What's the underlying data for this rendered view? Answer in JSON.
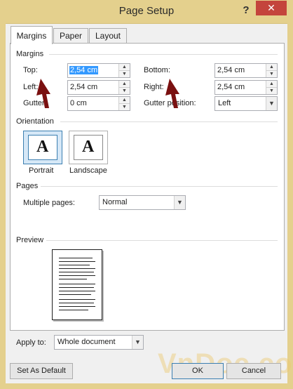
{
  "window": {
    "title": "Page Setup",
    "help": "?",
    "close": "✕"
  },
  "tabs": [
    {
      "label": "Margins",
      "active": true
    },
    {
      "label": "Paper",
      "active": false
    },
    {
      "label": "Layout",
      "active": false
    }
  ],
  "margins": {
    "section": "Margins",
    "top": {
      "label": "Top:",
      "value": "2,54 cm"
    },
    "bottom": {
      "label": "Bottom:",
      "value": "2,54 cm"
    },
    "left": {
      "label": "Left:",
      "value": "2,54 cm"
    },
    "right": {
      "label": "Right:",
      "value": "2,54 cm"
    },
    "gutter": {
      "label": "Gutter:",
      "value": "0 cm"
    },
    "gutter_position": {
      "label": "Gutter position:",
      "value": "Left"
    }
  },
  "orientation": {
    "section": "Orientation",
    "portrait": "Portrait",
    "landscape": "Landscape",
    "glyph": "A",
    "selected": "portrait"
  },
  "pages": {
    "section": "Pages",
    "multiple_label": "Multiple pages:",
    "multiple_value": "Normal"
  },
  "preview": {
    "section": "Preview"
  },
  "apply": {
    "label": "Apply to:",
    "value": "Whole document"
  },
  "buttons": {
    "set_default": "Set As Default",
    "ok": "OK",
    "cancel": "Cancel"
  },
  "watermark": "VnDoc.com",
  "colors": {
    "titlebar": "#e4d08d",
    "close": "#c4443c",
    "arrow": "#7a1010",
    "selection": "#3399ff"
  }
}
